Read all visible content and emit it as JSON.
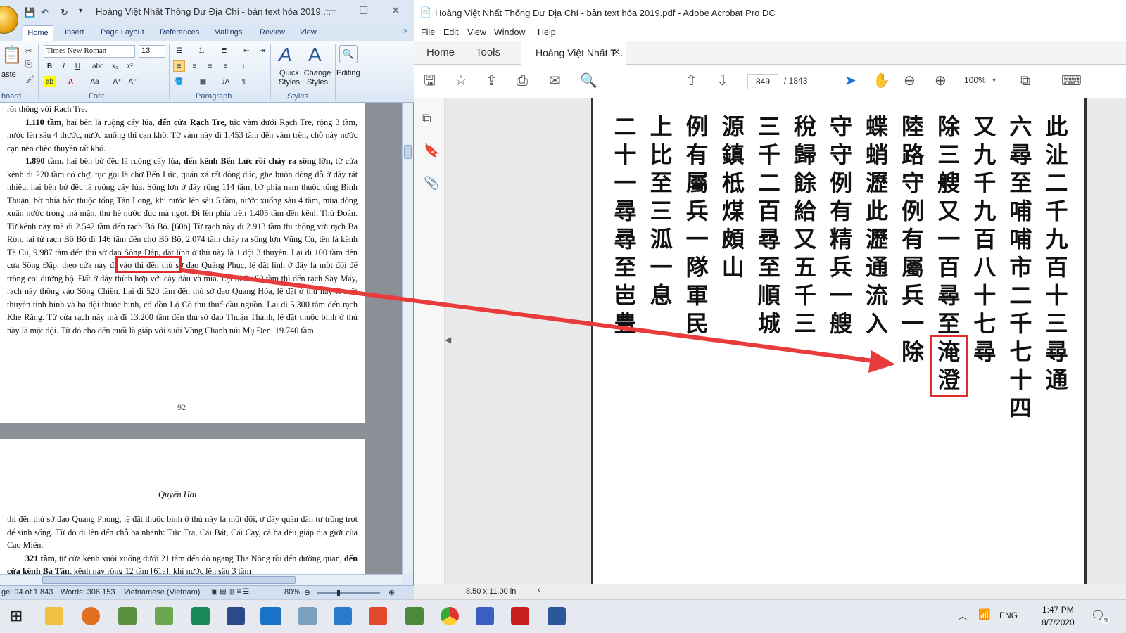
{
  "word": {
    "title": "Hoàng Việt Nhất Thống Dư Địa Chí - bản text hóa 2019....",
    "tabs": [
      "Home",
      "Insert",
      "Page Layout",
      "References",
      "Mailings",
      "Review",
      "View"
    ],
    "ribbon": {
      "paste": "aste",
      "clipboard": "board",
      "font_name": "Times New Roman",
      "font_size": "13",
      "font_group": "Font",
      "paragraph_group": "Paragraph",
      "styles_group": "Styles",
      "quick_styles": "Quick Styles",
      "change_styles": "Change Styles",
      "editing": "Editing"
    },
    "page1": {
      "top_line": "rồi thông với Rạch Tre.",
      "p1_bold": "1.110 tầm,",
      "p1a": " hai bên là ruộng cấy lúa, ",
      "p1_bold2": "đến cửa Rạch Tre,",
      "p1b": " tức vàm dưới Rạch Tre, rộng 3 tầm, nước lên sâu 4 thước, nước xuống thì cạn khô. Từ vàm này đi 1.453 tầm đến vàm trên, chỗ này nước cạn nên chèo thuyền rất khó.",
      "p2_bold": "1.890 tầm,",
      "p2a": " hai bên bờ đều là ruộng cấy lúa, ",
      "p2_bold2": "đến kênh Bến Lức rồi chảy ra sông lớn,",
      "p2b": " từ cửa kênh đi 220 tầm có chợ, tục gọi là chợ Bến Lức, quán xá rất đông đúc, ghe buôn đông đỗ ở đây rất nhiều, hai bên bờ đều là ruộng cấy lúa. Sông lớn ở đây rộng 114 tầm, bờ phía nam thuộc tổng Bình Thuận, bờ phía bắc thuộc tổng Tân Long, khi nước lên sâu 5 tầm, nước xuống sâu 4 tầm, mùa đông xuân nước trong mà mặn, thu hè nước đục mà ngọt. Đi lên phía trên 1.405 tầm đến kênh Thủ Đoàn. Từ kênh này mà đi 2.542 tầm đến rạch Bô Bô. [60b] Từ rạch này đi 2.913 tầm thì thông với rạch Ba Ròn, lại từ rạch Bô Bô đi 146 tầm đến chợ Bô Bô, 2.074 tầm chảy ra sông lớn Vũng Cù, tên là kênh Tà Cú, 9.987 tầm đến thủ sở đạo Sông Đập, đặt lính ở thủ này là 1 đội 3 thuyền. Lại đi 100 tầm đến cửa Sông Đập, theo cửa này đi vào thì đến thủ sở đạo Quảng Phục, lệ đặt lính ở đây là một đội để trông coi đường bộ. Đất ở đây thích hợp với cây dâu và mía. Lại đi 8.160 tầm thì đến rạch Sày Máy, rạch này thông vào Sông Chiên. Lại đi 520 tầm đến thủ sở đạo Quang Hóa, lệ đặt ở thủ này là một thuyền tinh binh và ba đội thuộc binh, có đồn Lộ Cô thu thuế đầu nguồn. Lại đi 5.300 tầm đến rạch Khe Răng. Từ cửa rạch này mà đi 13.200 tầm đến thủ sở đạo Thuận Thành, lệ đặt thuộc binh ở thủ này là một đội. Từ đó cho đến cuối là giáp với suối Vàng Chanh núi Mụ Đen. 19.740 tầm",
      "page_number": "92"
    },
    "page2": {
      "chapter": "Quyển Hai",
      "p1": "thì đến thủ sở đạo Quang Phong, lệ đặt thuộc binh ở thủ này là một đội, ở đây quân dân tự trồng trọt để sinh sống. Từ đó đi lên đến chỗ ba nhánh: Tức Tra, Cái Bát, Cái Cạy, cả ba đều giáp địa giới của Cao Miên.",
      "p2_bold": "321 tầm,",
      "p2a": " từ cửa kênh xuôi xuống dưới 21 tầm đến đò ngang Tha Nông rồi đến đường quan, ",
      "p2_bold2": "đến cửa kênh Bà Tân,",
      "p2b": " kênh này rộng 12 tầm [61a], khi nước lên sâu 3 tầm"
    },
    "status": {
      "page": "ge: 94 of 1,843",
      "words": "Words: 306,153",
      "language": "Vietnamese (Vietnam)",
      "zoom": "80%"
    }
  },
  "acrobat": {
    "title": "Hoàng Việt Nhất Thống Dư Địa Chí - bản text hóa 2019.pdf - Adobe Acrobat Pro DC",
    "menu": [
      "File",
      "Edit",
      "View",
      "Window",
      "Help"
    ],
    "tabs": {
      "home": "Home",
      "tools": "Tools",
      "doc": "Hoàng Việt Nhất T..."
    },
    "page_current": "849",
    "page_total": "/ 1843",
    "zoom": "100%",
    "page_size": "8.50 x 11.00 in",
    "columns": [
      "此沚二千九百十三尋通",
      "六尋至哺哺市二千七十四",
      "又九千九百八十七尋",
      "除三艘又一百尋至淹澄",
      "陸路守例有屬兵一除",
      "蝶蛸瀝此瀝通流入",
      "守守例有精兵一艘",
      "稅歸餘給又五千三",
      "三千二百尋至順城",
      "源鎮柢煤頗山",
      "例有屬兵一隊軍民",
      "上比至三泒一息",
      "二十一尋尋至岜豊"
    ],
    "highlight": "淹澄"
  },
  "taskbar": {
    "lang": "ENG",
    "time": "1:47 PM",
    "date": "8/7/2020",
    "notif": "9"
  },
  "colors": {
    "highlight_red": "#e02b2b",
    "word_blue": "#2b579a"
  }
}
